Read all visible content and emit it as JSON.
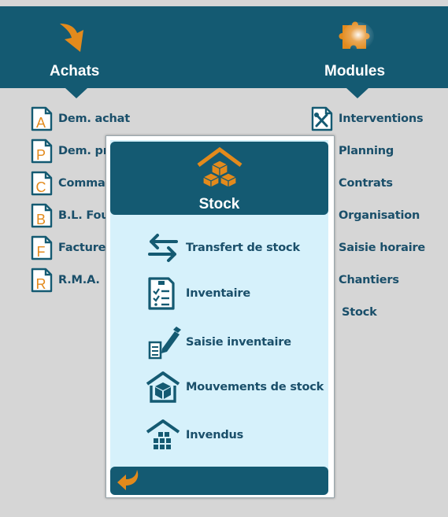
{
  "achats": {
    "title": "Achats",
    "icon": "arrow-down-right-icon",
    "items": [
      {
        "letter": "A",
        "label": "Dem. achat"
      },
      {
        "letter": "P",
        "label": "Dem. pr"
      },
      {
        "letter": "C",
        "label": "Commar"
      },
      {
        "letter": "B",
        "label": "B.L. Four"
      },
      {
        "letter": "F",
        "label": "Factures"
      },
      {
        "letter": "R",
        "label": "R.M.A."
      }
    ]
  },
  "modules": {
    "title": "Modules",
    "icon": "puzzle-icon",
    "items": [
      {
        "label": "Interventions"
      },
      {
        "label": "Planning"
      },
      {
        "label": "Contrats"
      },
      {
        "label": "Organisation"
      },
      {
        "label": "Saisie horaire"
      },
      {
        "label": "Chantiers"
      },
      {
        "label": "Stock"
      }
    ]
  },
  "popup": {
    "title": "Stock",
    "icon": "warehouse-boxes-icon",
    "items": [
      {
        "label": "Transfert de stock",
        "icon": "transfer-arrows-icon"
      },
      {
        "label": "Inventaire",
        "icon": "inventory-list-icon"
      },
      {
        "label": "Saisie inventaire",
        "icon": "edit-inventory-icon"
      },
      {
        "label": "Mouvements de stock",
        "icon": "stock-movement-icon"
      },
      {
        "label": "Invendus",
        "icon": "unsold-boxes-icon"
      }
    ],
    "back_icon": "back-arrow-icon"
  },
  "colors": {
    "header": "#145a72",
    "accent_orange": "#e38a1c",
    "text": "#1a4f6a",
    "popup_bg": "#d6f1fb",
    "page_bg": "#d6d6d6"
  }
}
